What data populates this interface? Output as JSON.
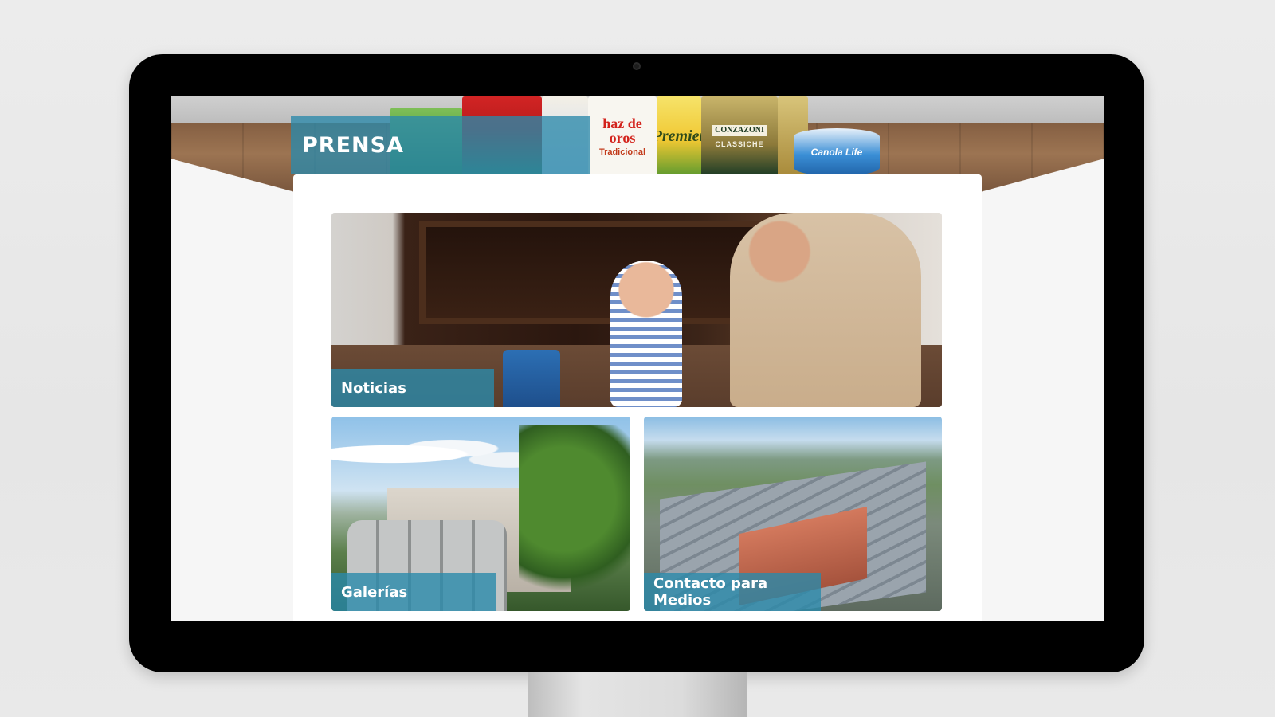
{
  "page": {
    "title": "PRENSA"
  },
  "hero": {
    "products": [
      {
        "name": "haz de oros",
        "sub": "Tradicional"
      },
      {
        "name": "Premier"
      },
      {
        "name": "CONZAZONI",
        "sub": "CLASSICHE"
      },
      {
        "name": "Canola Life"
      }
    ]
  },
  "tiles": [
    {
      "label": "Noticias"
    },
    {
      "label": "Galerías"
    },
    {
      "label": "Contacto para Medios"
    }
  ],
  "colors": {
    "accent_overlay": "#2B89AA",
    "monitor_bezel": "#000000",
    "background": "#ECECEC"
  }
}
